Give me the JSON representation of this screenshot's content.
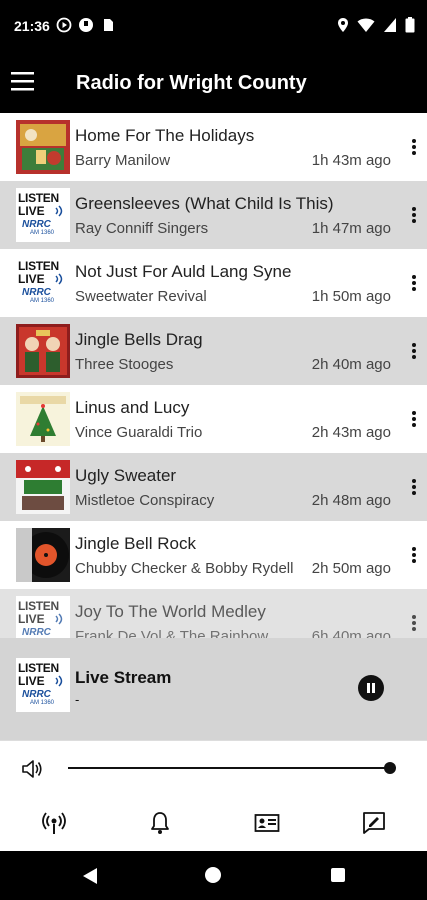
{
  "status": {
    "time": "21:36"
  },
  "app": {
    "title": "Radio for Wright County"
  },
  "logo_text": {
    "line1": "LISTEN",
    "line2": "LIVE",
    "brand": "NRRC",
    "sub": "AM 1360"
  },
  "tracks": [
    {
      "song": "Home For The Holidays",
      "artist": "Barry Manilow",
      "ago": "1h 43m ago",
      "art": "holiday-album-art"
    },
    {
      "song": "Greensleeves (What Child Is This)",
      "artist": "Ray Conniff Singers",
      "ago": "1h 47m ago",
      "art": "listen-live-logo"
    },
    {
      "song": "Not Just For Auld Lang Syne",
      "artist": "Sweetwater Revival",
      "ago": "1h 50m ago",
      "art": "listen-live-logo"
    },
    {
      "song": "Jingle Bells Drag",
      "artist": "Three Stooges",
      "ago": "2h 40m ago",
      "art": "stooges-album-art"
    },
    {
      "song": "Linus and Lucy",
      "artist": "Vince Guaraldi Trio",
      "ago": "2h 43m ago",
      "art": "charlie-brown-album-art"
    },
    {
      "song": "Ugly Sweater",
      "artist": "Mistletoe Conspiracy",
      "ago": "2h 48m ago",
      "art": "mistletoe-album-art"
    },
    {
      "song": "Jingle Bell Rock",
      "artist": "Chubby Checker & Bobby Rydell",
      "ago": "2h 50m ago",
      "art": "record-album-art"
    },
    {
      "song": "Joy To The World Medley",
      "artist": "Frank De Vol & The Rainbow",
      "ago": "6h 40m ago",
      "art": "listen-live-logo"
    }
  ],
  "player": {
    "title": "Live Stream",
    "subtitle": "-"
  },
  "volume": {
    "level": 1.0
  },
  "nav": [
    "podcast-icon",
    "bell-icon",
    "contact-card-icon",
    "chat-icon"
  ],
  "colors": {
    "bar": "#000000",
    "row_alt": "#d9d9d9",
    "player_bg": "#d4d4d4"
  }
}
